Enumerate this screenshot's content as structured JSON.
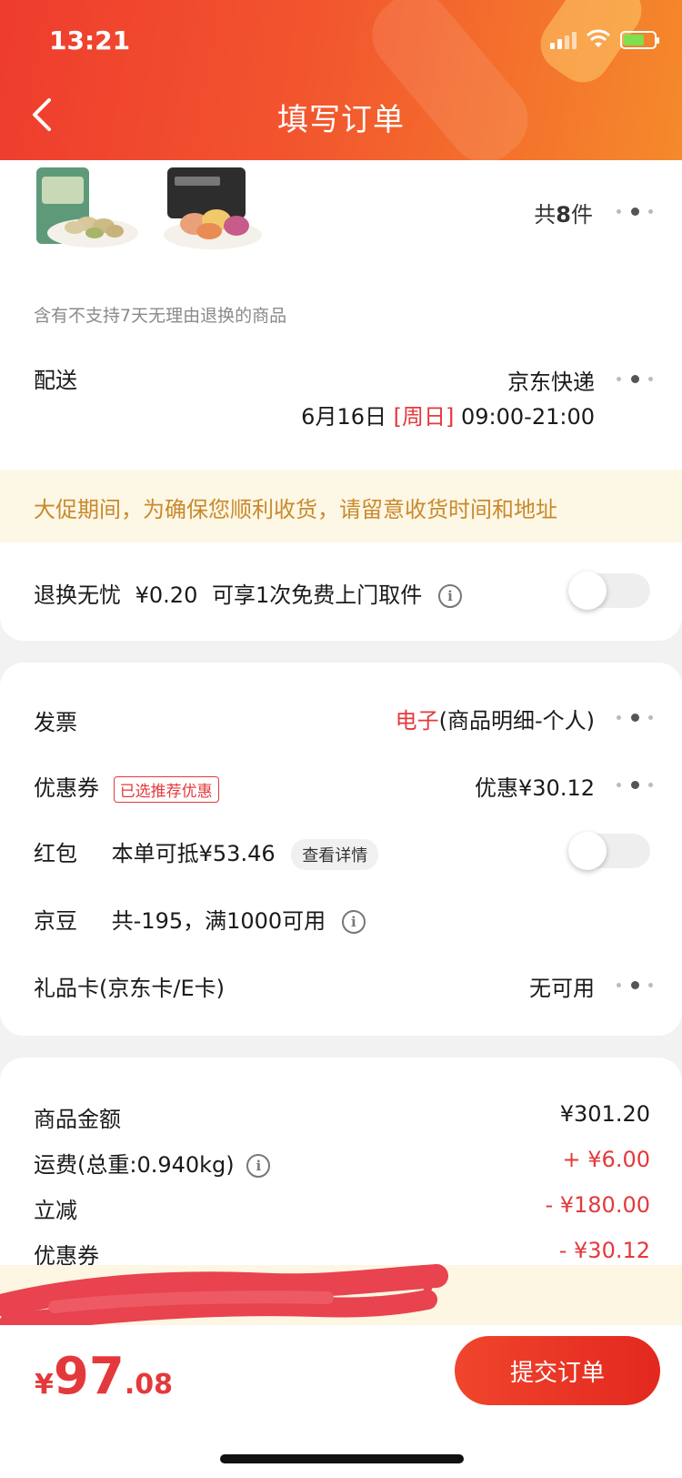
{
  "status_bar": {
    "time": "13:21"
  },
  "header": {
    "title": "填写订单"
  },
  "products": {
    "images": [
      "pistachio-bag-icon",
      "vegetable-chips-bag-icon"
    ],
    "count_prefix": "共",
    "count": "8",
    "count_suffix": "件"
  },
  "notice": "含有不支持7天无理由退换的商品",
  "delivery": {
    "label": "配送",
    "carrier": "京东快递",
    "date": "6月16日",
    "weekday": "[周日]",
    "time_range": "09:00-21:00"
  },
  "banner": "大促期间，为确保您顺利收货，请留意收货时间和地址",
  "return_service": {
    "label": "退换无忧",
    "price": "¥0.20",
    "desc": "可享1次免费上门取件",
    "enabled": false
  },
  "invoice": {
    "label": "发票",
    "type": "电子",
    "detail": "(商品明细-个人)"
  },
  "coupon": {
    "label": "优惠券",
    "tag": "已选推荐优惠",
    "value": "优惠¥30.12"
  },
  "red_packet": {
    "label": "红包",
    "desc": "本单可抵¥53.46",
    "button": "查看详情",
    "enabled": false
  },
  "jingdou": {
    "label": "京豆",
    "desc": "共-195，满1000可用"
  },
  "gift_card": {
    "label": "礼品卡(京东卡/E卡)",
    "value": "无可用"
  },
  "summary": {
    "goods_label": "商品金额",
    "goods_value": "¥301.20",
    "freight_label": "运费(总重:0.940kg)",
    "freight_value": "+ ¥6.00",
    "discount_label": "立减",
    "discount_value": "- ¥180.00",
    "coupon_label": "优惠券",
    "coupon_value": "- ¥30.12"
  },
  "footer": {
    "currency": "¥",
    "total_int": "97",
    "total_dec": ".08",
    "submit_label": "提交订单"
  },
  "colors": {
    "accent": "#e4393c",
    "header_start": "#ee3c2e",
    "header_end": "#f58a2b",
    "banner_text": "#c98a2c"
  }
}
